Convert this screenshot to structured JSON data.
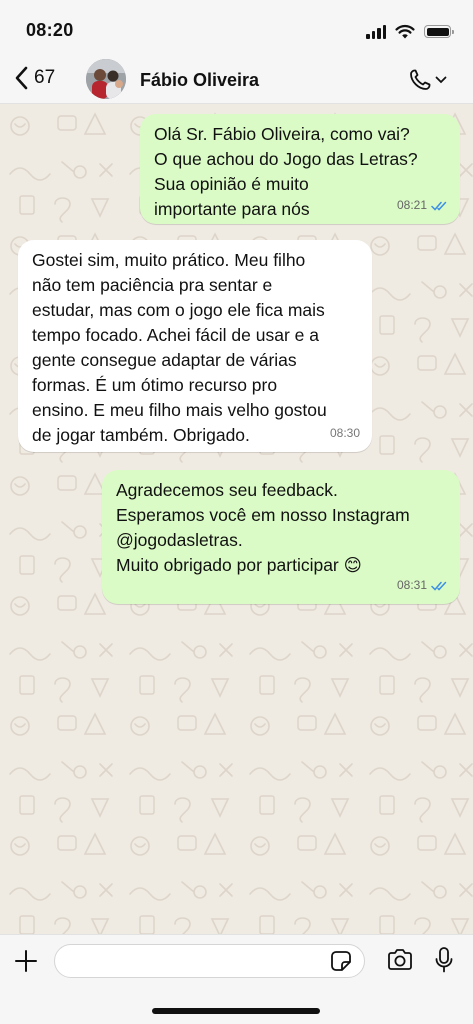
{
  "status_bar": {
    "time": "08:20",
    "icons": [
      "cellular-signal-icon",
      "wifi-icon",
      "battery-icon"
    ]
  },
  "header": {
    "back_count": "67",
    "contact_name": "Fábio Oliveira",
    "icons": [
      "chevron-left-icon",
      "phone-icon",
      "chevron-down-icon"
    ]
  },
  "messages": [
    {
      "direction": "outgoing",
      "text": "Olá Sr. Fábio Oliveira, como vai?\nO que achou do Jogo das Letras?\nSua opinião é muito\nimportante para nós",
      "time": "08:21",
      "status": "read"
    },
    {
      "direction": "incoming",
      "text": "Gostei sim, muito prático. Meu filho\nnão tem paciência pra sentar e\nestudar, mas com o jogo ele fica mais\ntempo focado. Achei fácil de usar e a\ngente consegue adaptar de várias\nformas. É um ótimo recurso pro\nensino. E meu filho mais velho gostou\nde jogar também. Obrigado.",
      "time": "08:30"
    },
    {
      "direction": "outgoing",
      "text": "Agradecemos seu feedback.\nEsperamos você em nosso Instagram\n@jogodasletras.\nMuito obrigado por participar 😊",
      "time": "08:31",
      "status": "read"
    }
  ],
  "input": {
    "value": "",
    "placeholder": ""
  },
  "colors": {
    "outgoing_bubble": "#dafbc5",
    "incoming_bubble": "#ffffff",
    "chat_background": "#efeae2",
    "read_ticks": "#3b8fe6"
  }
}
